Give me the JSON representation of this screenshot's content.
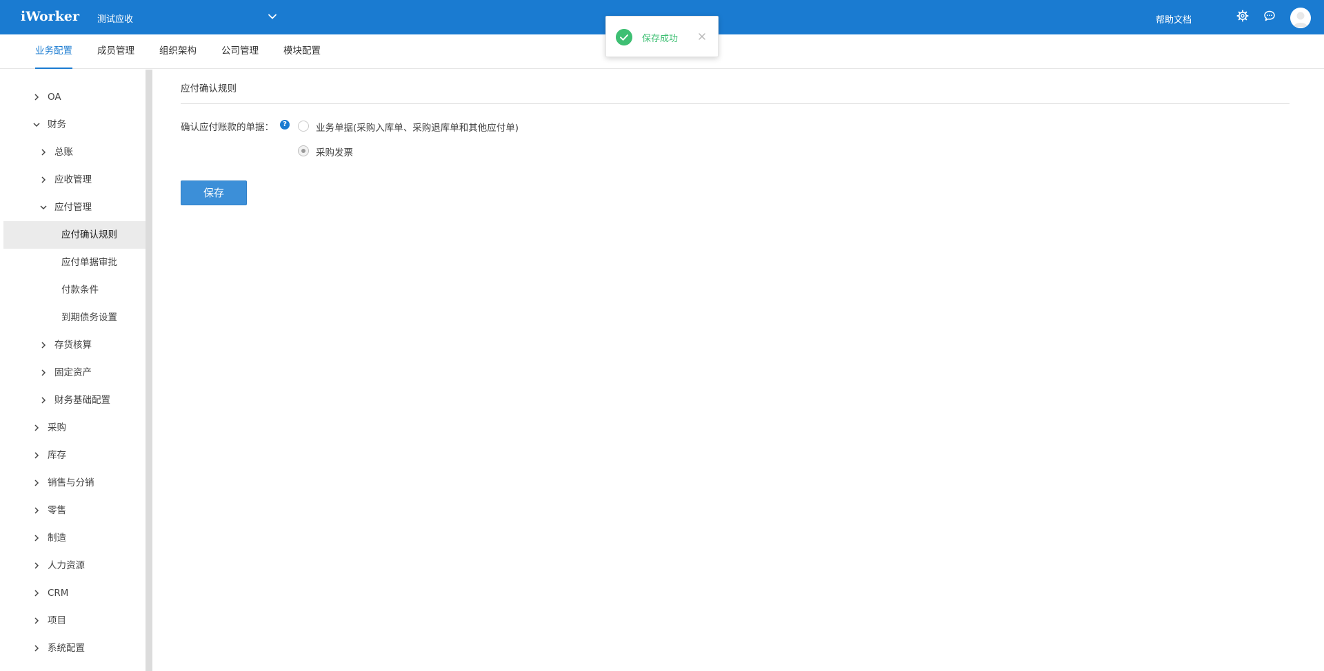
{
  "header": {
    "logo": "iWorker",
    "company": "测试应收",
    "help_link": "帮助文档",
    "icons": [
      "chevron-down-icon",
      "gear-icon",
      "chat-icon",
      "avatar"
    ],
    "bg_color": "#1a7bd1"
  },
  "nav": {
    "tabs": [
      {
        "label": "业务配置",
        "active": true
      },
      {
        "label": "成员管理",
        "active": false
      },
      {
        "label": "组织架构",
        "active": false
      },
      {
        "label": "公司管理",
        "active": false
      },
      {
        "label": "模块配置",
        "active": false
      }
    ]
  },
  "sidebar": {
    "items": [
      {
        "label": "OA",
        "level": 1,
        "expanded": false
      },
      {
        "label": "财务",
        "level": 1,
        "expanded": true
      },
      {
        "label": "总账",
        "level": 2,
        "expanded": false
      },
      {
        "label": "应收管理",
        "level": 2,
        "expanded": false
      },
      {
        "label": "应付管理",
        "level": 2,
        "expanded": true
      },
      {
        "label": "应付确认规则",
        "level": 3,
        "active": true
      },
      {
        "label": "应付单据审批",
        "level": 3
      },
      {
        "label": "付款条件",
        "level": 3
      },
      {
        "label": "到期债务设置",
        "level": 3
      },
      {
        "label": "存货核算",
        "level": 2,
        "expanded": false
      },
      {
        "label": "固定资产",
        "level": 2,
        "expanded": false
      },
      {
        "label": "财务基础配置",
        "level": 2,
        "expanded": false
      },
      {
        "label": "采购",
        "level": 1,
        "expanded": false
      },
      {
        "label": "库存",
        "level": 1,
        "expanded": false
      },
      {
        "label": "销售与分销",
        "level": 1,
        "expanded": false
      },
      {
        "label": "零售",
        "level": 1,
        "expanded": false
      },
      {
        "label": "制造",
        "level": 1,
        "expanded": false
      },
      {
        "label": "人力资源",
        "level": 1,
        "expanded": false
      },
      {
        "label": "CRM",
        "level": 1,
        "expanded": false
      },
      {
        "label": "项目",
        "level": 1,
        "expanded": false
      },
      {
        "label": "系统配置",
        "level": 1,
        "expanded": false
      }
    ]
  },
  "main": {
    "section_title": "应付确认规则",
    "field_label": "确认应付账款的单据：",
    "help_icon": "?",
    "options": [
      {
        "label": "业务单据(采购入库单、采购退库单和其他应付单)",
        "checked": false
      },
      {
        "label": "采购发票",
        "checked": true
      }
    ],
    "save_label": "保存"
  },
  "toast": {
    "message": "保存成功",
    "icon": "check-circle-icon",
    "color": "#3ebf73"
  }
}
